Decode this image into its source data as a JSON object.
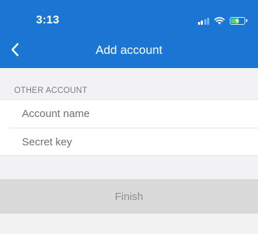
{
  "status_bar": {
    "time": "3:13",
    "signal_icon": "cellular-signal-icon",
    "wifi_icon": "wifi-icon",
    "battery_icon": "battery-charging-icon",
    "battery_level": 0.55
  },
  "nav": {
    "back_icon": "chevron-left-icon",
    "title": "Add account"
  },
  "form": {
    "section_header": "OTHER ACCOUNT",
    "account_name": {
      "value": "",
      "placeholder": "Account name"
    },
    "secret_key": {
      "value": "",
      "placeholder": "Secret key"
    }
  },
  "actions": {
    "finish_label": "Finish"
  },
  "colors": {
    "header_bg": "#1a76d2",
    "page_bg": "#f2f2f4",
    "button_bg": "#dadada",
    "button_text": "#8e8e93"
  }
}
